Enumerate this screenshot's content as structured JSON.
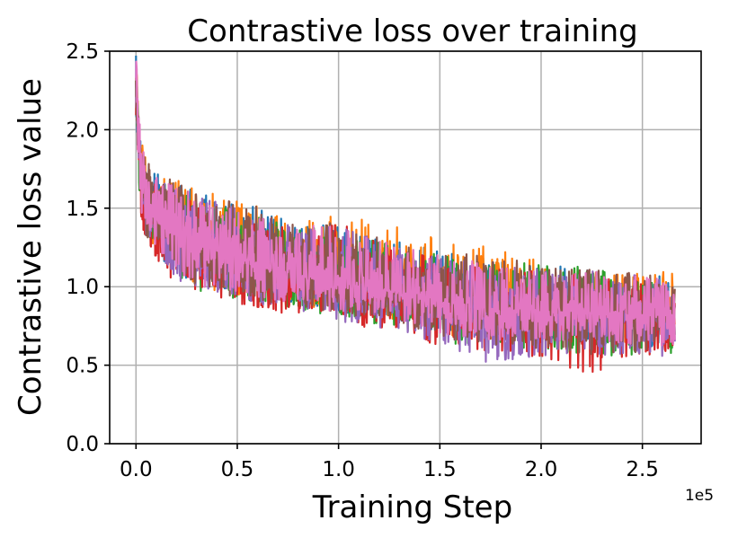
{
  "chart_data": {
    "type": "line",
    "title": "Contrastive loss over training",
    "xlabel": "Training Step",
    "ylabel": "Contrastive loss value",
    "x_offset_label": "1e5",
    "xlim": [
      -0.13,
      2.79
    ],
    "ylim": [
      0.0,
      2.5
    ],
    "x_ticks": [
      0.0,
      0.5,
      1.0,
      1.5,
      2.0,
      2.5
    ],
    "x_tick_labels": [
      "0.0",
      "0.5",
      "1.0",
      "1.5",
      "2.0",
      "2.5"
    ],
    "y_ticks": [
      0.0,
      0.5,
      1.0,
      1.5,
      2.0,
      2.5
    ],
    "y_tick_labels": [
      "0.0",
      "0.5",
      "1.0",
      "1.5",
      "2.0",
      "2.5"
    ],
    "grid": true,
    "legend": "none",
    "x_scale_note": "x values in units of 1e5 steps",
    "series": [
      {
        "color": "#1f77b4",
        "x": [
          0.0,
          0.02,
          0.05,
          0.1,
          0.2,
          0.3,
          0.5,
          0.75,
          1.0,
          1.25,
          1.5,
          1.75,
          2.0,
          2.25,
          2.5,
          2.66
        ],
        "mean": [
          2.3,
          1.8,
          1.55,
          1.45,
          1.35,
          1.28,
          1.18,
          1.09,
          1.02,
          0.97,
          0.9,
          0.86,
          0.84,
          0.83,
          0.82,
          0.82
        ],
        "min": [
          2.1,
          1.5,
          1.3,
          1.2,
          1.1,
          1.0,
          0.95,
          0.88,
          0.84,
          0.8,
          0.7,
          0.66,
          0.65,
          0.64,
          0.62,
          0.62
        ],
        "max": [
          2.5,
          2.0,
          1.75,
          1.72,
          1.68,
          1.6,
          1.55,
          1.42,
          1.38,
          1.3,
          1.25,
          1.18,
          1.15,
          1.12,
          1.1,
          1.05
        ]
      },
      {
        "color": "#ff7f0e",
        "x": [
          0.0,
          0.02,
          0.05,
          0.1,
          0.2,
          0.3,
          0.5,
          0.75,
          1.0,
          1.25,
          1.5,
          1.75,
          2.0,
          2.25,
          2.5,
          2.66
        ],
        "mean": [
          2.32,
          1.82,
          1.57,
          1.46,
          1.36,
          1.29,
          1.19,
          1.1,
          1.03,
          0.98,
          0.91,
          0.87,
          0.85,
          0.84,
          0.83,
          0.83
        ],
        "min": [
          2.1,
          1.5,
          1.3,
          1.2,
          1.1,
          1.0,
          0.95,
          0.88,
          0.84,
          0.8,
          0.7,
          0.66,
          0.65,
          0.64,
          0.62,
          0.62
        ],
        "max": [
          2.5,
          2.0,
          1.8,
          1.75,
          1.7,
          1.62,
          1.55,
          1.45,
          1.45,
          1.4,
          1.3,
          1.25,
          1.2,
          1.15,
          1.12,
          1.08
        ]
      },
      {
        "color": "#2ca02c",
        "x": [
          0.0,
          0.02,
          0.05,
          0.1,
          0.2,
          0.3,
          0.5,
          0.75,
          1.0,
          1.25,
          1.5,
          1.75,
          2.0,
          2.25,
          2.5,
          2.66
        ],
        "mean": [
          2.28,
          1.79,
          1.54,
          1.44,
          1.34,
          1.27,
          1.17,
          1.08,
          1.01,
          0.96,
          0.89,
          0.85,
          0.83,
          0.82,
          0.81,
          0.81
        ],
        "min": [
          2.1,
          1.5,
          1.28,
          1.18,
          1.05,
          0.98,
          0.9,
          0.85,
          0.8,
          0.75,
          0.65,
          0.6,
          0.58,
          0.56,
          0.55,
          0.53
        ],
        "max": [
          2.45,
          1.95,
          1.7,
          1.68,
          1.62,
          1.55,
          1.48,
          1.4,
          1.35,
          1.28,
          1.2,
          1.16,
          1.22,
          1.12,
          1.08,
          1.02
        ]
      },
      {
        "color": "#d62728",
        "x": [
          0.0,
          0.02,
          0.05,
          0.1,
          0.2,
          0.3,
          0.5,
          0.75,
          1.0,
          1.25,
          1.5,
          1.75,
          2.0,
          2.25,
          2.5,
          2.66
        ],
        "mean": [
          2.25,
          1.77,
          1.52,
          1.42,
          1.32,
          1.25,
          1.15,
          1.06,
          0.99,
          0.94,
          0.87,
          0.83,
          0.81,
          0.8,
          0.79,
          0.79
        ],
        "min": [
          2.0,
          1.43,
          1.25,
          1.15,
          1.0,
          0.93,
          0.88,
          0.82,
          0.76,
          0.72,
          0.62,
          0.58,
          0.55,
          0.43,
          0.55,
          0.55
        ],
        "max": [
          2.4,
          1.9,
          1.68,
          1.65,
          1.6,
          1.52,
          1.45,
          1.38,
          1.42,
          1.25,
          1.18,
          1.12,
          1.1,
          1.08,
          1.05,
          1.0
        ]
      },
      {
        "color": "#9467bd",
        "x": [
          0.0,
          0.02,
          0.05,
          0.1,
          0.2,
          0.3,
          0.5,
          0.75,
          1.0,
          1.25,
          1.5,
          1.75,
          2.0,
          2.25,
          2.5,
          2.66
        ],
        "mean": [
          2.3,
          1.78,
          1.53,
          1.43,
          1.33,
          1.26,
          1.16,
          1.07,
          1.0,
          0.95,
          0.88,
          0.84,
          0.82,
          0.81,
          0.8,
          0.8
        ],
        "min": [
          2.05,
          1.45,
          1.27,
          1.17,
          1.05,
          0.97,
          0.9,
          0.84,
          0.78,
          0.73,
          0.63,
          0.5,
          0.56,
          0.55,
          0.54,
          0.55
        ],
        "max": [
          2.45,
          1.95,
          1.72,
          1.7,
          1.65,
          1.58,
          1.5,
          1.4,
          1.38,
          1.28,
          1.2,
          1.15,
          1.12,
          1.1,
          1.07,
          1.03
        ]
      },
      {
        "color": "#8c564b",
        "x": [
          0.0,
          0.02,
          0.05,
          0.1,
          0.2,
          0.3,
          0.5,
          0.75,
          1.0,
          1.25,
          1.5,
          1.75,
          2.0,
          2.25,
          2.5,
          2.66
        ],
        "mean": [
          2.35,
          1.83,
          1.58,
          1.48,
          1.37,
          1.3,
          1.2,
          1.11,
          1.04,
          0.99,
          0.92,
          0.88,
          0.86,
          0.85,
          0.84,
          0.84
        ],
        "min": [
          2.1,
          1.55,
          1.32,
          1.22,
          1.08,
          1.0,
          0.93,
          0.87,
          0.82,
          0.78,
          0.68,
          0.62,
          0.6,
          0.56,
          0.58,
          0.6
        ],
        "max": [
          2.5,
          1.9,
          1.8,
          1.75,
          1.7,
          1.62,
          1.55,
          1.45,
          1.4,
          1.3,
          1.22,
          1.2,
          1.15,
          1.12,
          1.08,
          1.05
        ]
      },
      {
        "color": "#e377c2",
        "x": [
          0.0,
          0.02,
          0.05,
          0.1,
          0.2,
          0.3,
          0.5,
          0.75,
          1.0,
          1.25,
          1.5,
          1.75,
          2.0,
          2.25,
          2.5,
          2.66
        ],
        "mean": [
          2.4,
          1.8,
          1.55,
          1.45,
          1.35,
          1.28,
          1.18,
          1.09,
          1.02,
          0.97,
          0.9,
          0.86,
          0.84,
          0.83,
          0.82,
          0.82
        ],
        "min": [
          2.2,
          1.5,
          1.3,
          1.2,
          1.1,
          1.0,
          0.95,
          0.88,
          0.84,
          0.8,
          0.7,
          0.66,
          0.65,
          0.64,
          0.62,
          0.62
        ],
        "max": [
          2.5,
          2.0,
          1.75,
          1.7,
          1.65,
          1.58,
          1.5,
          1.4,
          1.38,
          1.28,
          1.2,
          1.15,
          1.12,
          1.1,
          1.07,
          1.03
        ]
      }
    ]
  }
}
